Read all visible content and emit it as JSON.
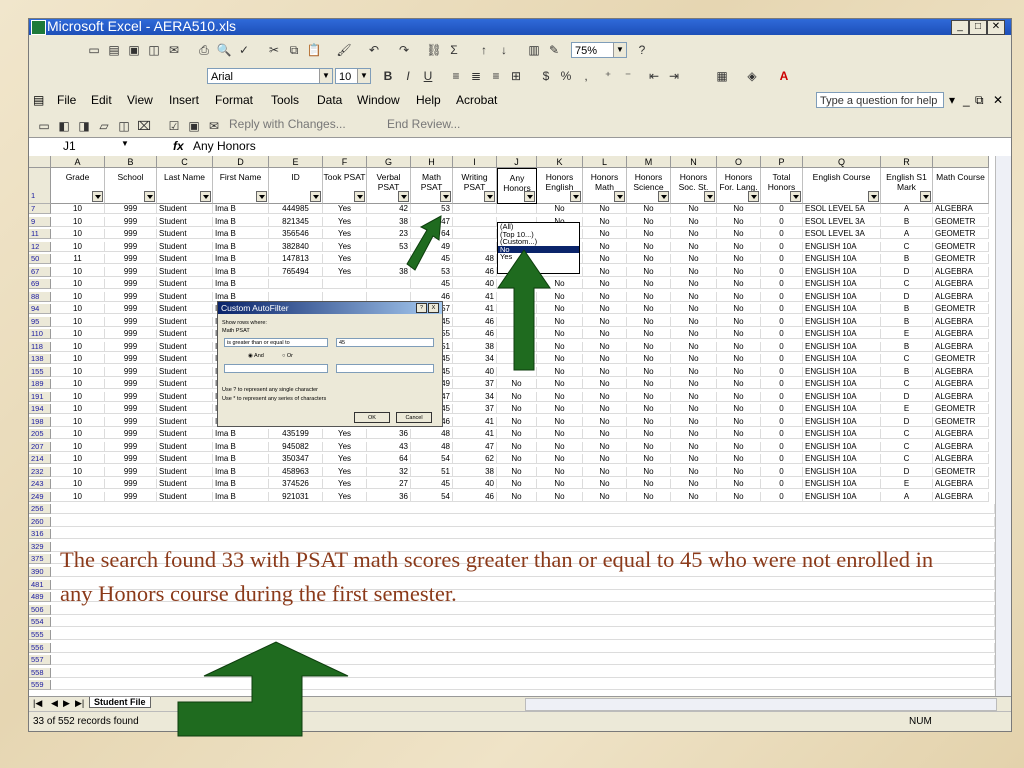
{
  "window": {
    "title": "Microsoft Excel - AERA510.xls"
  },
  "toolbar": {
    "font": "Arial",
    "size": "10",
    "zoom": "75%"
  },
  "menus": [
    "File",
    "Edit",
    "View",
    "Insert",
    "Format",
    "Tools",
    "Data",
    "Window",
    "Help",
    "Acrobat"
  ],
  "help_box": {
    "placeholder": "Type a question for help"
  },
  "reviewbar": {
    "reply": "Reply with Changes...",
    "end": "End Review..."
  },
  "formula": {
    "cell_ref": "J1",
    "fx": "fx",
    "content": "Any Honors"
  },
  "columns": [
    "A",
    "B",
    "C",
    "D",
    "E",
    "F",
    "G",
    "H",
    "I",
    "J",
    "K",
    "L",
    "M",
    "N",
    "O",
    "P",
    "Q",
    "R"
  ],
  "headers": [
    "Grade",
    "School",
    "Last Name",
    "First Name",
    "ID",
    "Took PSAT",
    "Verbal PSAT",
    "Math PSAT",
    "Writing PSAT",
    "Any Honors",
    "Honors English",
    "Honors Math",
    "Honors Science",
    "Honors Soc. St.",
    "Honors For. Lang.",
    "Total Honors",
    "English Course",
    "English S1 Mark",
    "Math Course"
  ],
  "header_row_num": "1",
  "rows": [
    {
      "n": "7",
      "id": "444985",
      "took": "Yes",
      "v": "42",
      "m": "53",
      "w": "",
      "j": "",
      "q": "ESOL LEVEL 5A",
      "r": "A",
      "s": "ALGEBRA"
    },
    {
      "n": "9",
      "id": "821345",
      "took": "Yes",
      "v": "38",
      "m": "47",
      "w": "",
      "j": "",
      "q": "ESOL LEVEL 3A",
      "r": "B",
      "s": "GEOMETR"
    },
    {
      "n": "11",
      "id": "356546",
      "took": "Yes",
      "v": "23",
      "m": "64",
      "w": "",
      "j": "",
      "q": "ESOL LEVEL 3A",
      "r": "A",
      "s": "GEOMETR"
    },
    {
      "n": "12",
      "id": "382840",
      "took": "Yes",
      "v": "53",
      "m": "49",
      "w": "",
      "j": "",
      "q": "ENGLISH 10A",
      "r": "C",
      "s": "GEOMETR"
    },
    {
      "n": "50",
      "id": "147813",
      "took": "Yes",
      "v": "",
      "m": "45",
      "w": "48",
      "j": "No",
      "q": "ENGLISH 10A",
      "r": "B",
      "s": "GEOMETR"
    },
    {
      "n": "67",
      "id": "765494",
      "took": "Yes",
      "v": "38",
      "m": "53",
      "w": "46",
      "j": "",
      "q": "ENGLISH 10A",
      "r": "D",
      "s": "ALGEBRA"
    },
    {
      "n": "69",
      "id": "",
      "took": "",
      "v": "",
      "m": "45",
      "w": "40",
      "j": "",
      "q": "ENGLISH 10A",
      "r": "C",
      "s": "ALGEBRA"
    },
    {
      "n": "88",
      "id": "",
      "took": "",
      "v": "",
      "m": "46",
      "w": "41",
      "j": "",
      "q": "ENGLISH 10A",
      "r": "D",
      "s": "ALGEBRA"
    },
    {
      "n": "94",
      "id": "",
      "took": "",
      "v": "",
      "m": "57",
      "w": "41",
      "j": "",
      "q": "ENGLISH 10A",
      "r": "B",
      "s": "GEOMETR"
    },
    {
      "n": "95",
      "id": "",
      "took": "",
      "v": "",
      "m": "45",
      "w": "46",
      "j": "",
      "q": "ENGLISH 10A",
      "r": "B",
      "s": "ALGEBRA"
    },
    {
      "n": "110",
      "id": "",
      "took": "",
      "v": "",
      "m": "55",
      "w": "46",
      "j": "",
      "q": "ENGLISH 10A",
      "r": "E",
      "s": "ALGEBRA"
    },
    {
      "n": "118",
      "id": "",
      "took": "",
      "v": "",
      "m": "51",
      "w": "38",
      "j": "",
      "q": "ENGLISH 10A",
      "r": "B",
      "s": "ALGEBRA"
    },
    {
      "n": "138",
      "id": "",
      "took": "",
      "v": "",
      "m": "45",
      "w": "34",
      "j": "",
      "q": "ENGLISH 10A",
      "r": "C",
      "s": "GEOMETR"
    },
    {
      "n": "155",
      "id": "",
      "took": "",
      "v": "",
      "m": "45",
      "w": "40",
      "j": "",
      "q": "ENGLISH 10A",
      "r": "B",
      "s": "ALGEBRA"
    },
    {
      "n": "189",
      "id": "",
      "took": "",
      "v": "",
      "m": "49",
      "w": "37",
      "j": "No",
      "q": "ENGLISH 10A",
      "r": "C",
      "s": "ALGEBRA"
    },
    {
      "n": "191",
      "id": "",
      "took": "",
      "v": "",
      "m": "47",
      "w": "34",
      "j": "No",
      "q": "ENGLISH 10A",
      "r": "D",
      "s": "ALGEBRA"
    },
    {
      "n": "194",
      "id": "680318",
      "took": "Yes",
      "v": "21",
      "m": "45",
      "w": "37",
      "j": "No",
      "q": "ENGLISH 10A",
      "r": "E",
      "s": "GEOMETR"
    },
    {
      "n": "198",
      "id": "464500",
      "took": "Yes",
      "v": "37",
      "m": "46",
      "w": "41",
      "j": "No",
      "q": "ENGLISH 10A",
      "r": "D",
      "s": "GEOMETR"
    },
    {
      "n": "205",
      "id": "435199",
      "took": "Yes",
      "v": "36",
      "m": "48",
      "w": "41",
      "j": "No",
      "q": "ENGLISH 10A",
      "r": "C",
      "s": "ALGEBRA"
    },
    {
      "n": "207",
      "id": "945082",
      "took": "Yes",
      "v": "43",
      "m": "48",
      "w": "47",
      "j": "No",
      "q": "ENGLISH 10A",
      "r": "C",
      "s": "ALGEBRA"
    },
    {
      "n": "214",
      "id": "350347",
      "took": "Yes",
      "v": "64",
      "m": "54",
      "w": "62",
      "j": "No",
      "q": "ENGLISH 10A",
      "r": "C",
      "s": "ALGEBRA"
    },
    {
      "n": "232",
      "id": "458963",
      "took": "Yes",
      "v": "32",
      "m": "51",
      "w": "38",
      "j": "No",
      "q": "ENGLISH 10A",
      "r": "D",
      "s": "GEOMETR"
    },
    {
      "n": "243",
      "id": "374526",
      "took": "Yes",
      "v": "27",
      "m": "45",
      "w": "40",
      "j": "No",
      "q": "ENGLISH 10A",
      "r": "E",
      "s": "ALGEBRA"
    },
    {
      "n": "249",
      "id": "921031",
      "took": "Yes",
      "v": "36",
      "m": "54",
      "w": "46",
      "j": "No",
      "q": "ENGLISH 10A",
      "r": "A",
      "s": "ALGEBRA"
    }
  ],
  "common": {
    "grade": "10",
    "school": "999",
    "last": "Student",
    "first": "Ima B",
    "no": "No",
    "zero": "0"
  },
  "special_grade": {
    "row": "50",
    "grade": "11"
  },
  "empty_rows": [
    "256",
    "260",
    "316",
    "329",
    "375",
    "390",
    "481",
    "489",
    "506",
    "554",
    "555",
    "556",
    "557",
    "558",
    "559"
  ],
  "dropdown": {
    "items": [
      "(All)",
      "(Top 10...)",
      "(Custom...)",
      "No",
      "Yes"
    ],
    "selected": "No"
  },
  "dialog": {
    "title": "Custom AutoFilter",
    "show_rows": "Show rows where:",
    "field": "Math PSAT",
    "operator": "is greater than or equal to",
    "value": "45",
    "and_label": "And",
    "or_label": "Or",
    "hint1": "Use ? to represent any single character",
    "hint2": "Use * to represent any series of characters",
    "ok": "OK",
    "cancel": "Cancel",
    "help": "?",
    "close": "X"
  },
  "sheet_tab": "Student File",
  "status": {
    "text": "33 of 552 records found",
    "num": "NUM"
  },
  "caption": "The search found 33 with PSAT math scores greater than or equal to 45 who were not enrolled in any Honors course during the first semester.",
  "colors": {
    "arrow": "#1f6b1f",
    "caption": "#8b3a1a",
    "title_bar": "#1d4fb8"
  }
}
